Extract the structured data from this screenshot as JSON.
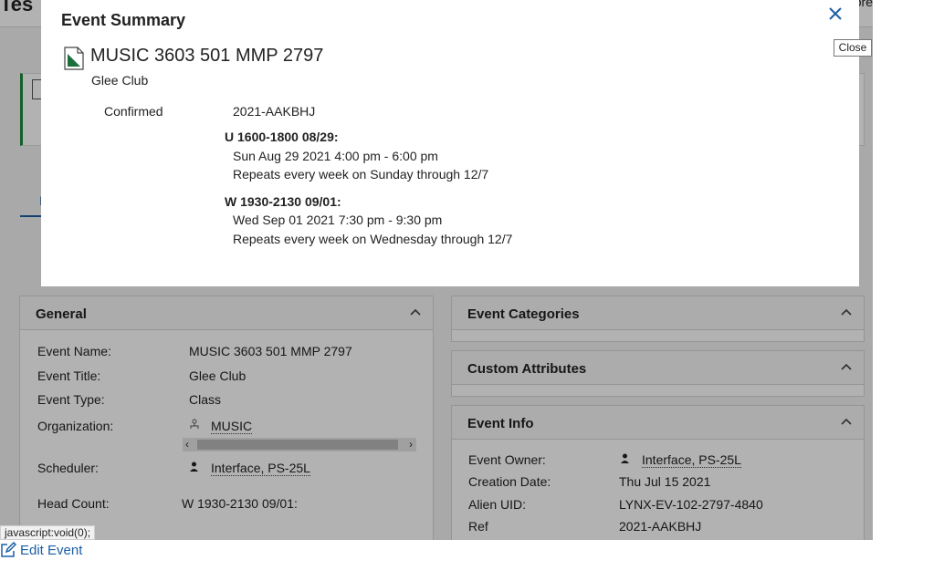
{
  "app": {
    "title_partial": "Tes",
    "header_right_partial": "ore",
    "tab_partial": "I"
  },
  "modal": {
    "title": "Event Summary",
    "close_tooltip": "Close",
    "event_name": "MUSIC 3603 501 MMP 2797",
    "event_title": "Glee Club",
    "status": "Confirmed",
    "reference": "2021-AAKBHJ",
    "occurrences": [
      {
        "heading": "U 1600-1800 08/29:",
        "datetime": "Sun Aug 29 2021 4:00 pm - 6:00 pm",
        "repeat": "Repeats every week on Sunday through 12/7"
      },
      {
        "heading": "W 1930-2130 09/01:",
        "datetime": "Wed Sep 01 2021 7:30 pm - 9:30 pm",
        "repeat": "Repeats every week on Wednesday through 12/7"
      }
    ]
  },
  "general": {
    "title": "General",
    "fields": {
      "event_name_label": "Event Name:",
      "event_name_value": "MUSIC 3603 501 MMP 2797",
      "event_title_label": "Event Title:",
      "event_title_value": "Glee Club",
      "event_type_label": "Event Type:",
      "event_type_value": "Class",
      "organization_label": "Organization:",
      "organization_value": "MUSIC",
      "scheduler_label": "Scheduler:",
      "scheduler_value": "Interface, PS-25L",
      "head_count_label": "Head Count:",
      "head_count_value": "W 1930-2130 09/01:"
    }
  },
  "event_categories": {
    "title": "Event Categories"
  },
  "custom_attributes": {
    "title": "Custom Attributes"
  },
  "event_info": {
    "title": "Event Info",
    "fields": {
      "owner_label": "Event Owner:",
      "owner_value": "Interface, PS-25L",
      "creation_label": "Creation Date:",
      "creation_value": "Thu Jul 15 2021",
      "alien_label": "Alien UID:",
      "alien_value": "LYNX-EV-102-2797-4840",
      "ref_label_partial": "Ref",
      "ref_value_partial": "2021-AAKBHJ"
    }
  },
  "statusbar": {
    "url": "javascript:void(0);"
  },
  "footer": {
    "edit_event_label": "Edit Event"
  },
  "colors": {
    "link_blue": "#1a5fa6",
    "accent_green": "#1c8a3a"
  }
}
